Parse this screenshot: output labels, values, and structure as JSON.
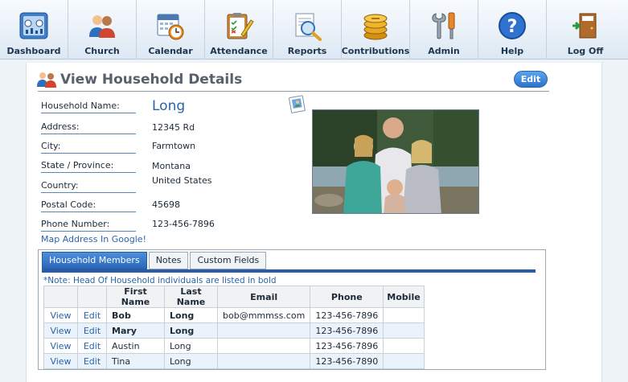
{
  "toolbar": {
    "items": [
      {
        "label": "Dashboard",
        "icon": "dashboard-icon"
      },
      {
        "label": "Church",
        "icon": "church-people-icon"
      },
      {
        "label": "Calendar",
        "icon": "calendar-icon"
      },
      {
        "label": "Attendance",
        "icon": "attendance-clipboard-icon"
      },
      {
        "label": "Reports",
        "icon": "reports-magnifier-icon"
      },
      {
        "label": "Contributions",
        "icon": "coins-icon"
      },
      {
        "label": "Admin",
        "icon": "tools-icon"
      },
      {
        "label": "Help",
        "icon": "help-icon"
      },
      {
        "label": "Log Off",
        "icon": "exit-door-icon"
      }
    ]
  },
  "page": {
    "title": "View Household Details",
    "edit_label": "Edit"
  },
  "household": {
    "labels": {
      "name": "Household Name:",
      "address": "Address:",
      "city": "City:",
      "state": "State / Province:",
      "country": "Country:",
      "postal": "Postal Code:",
      "phone": "Phone Number:"
    },
    "values": {
      "name": "Long",
      "address": "12345 Rd",
      "city": "Farmtown",
      "state": "Montana",
      "country": "United States",
      "postal": "45698",
      "phone": "123-456-7896"
    },
    "map_link": "Map Address In Google!"
  },
  "tabs": {
    "items": [
      "Household Members",
      "Notes",
      "Custom Fields"
    ],
    "active": 0
  },
  "members": {
    "note": "*Note: Head Of Household individuals are listed in bold",
    "headers": [
      "",
      "",
      "First Name",
      "Last Name",
      "Email",
      "Phone",
      "Mobile"
    ],
    "view_label": "View",
    "edit_label": "Edit",
    "rows": [
      {
        "first": "Bob",
        "last": "Long",
        "email": "bob@mmmss.com",
        "phone": "123-456-7896",
        "mobile": "",
        "bold": true
      },
      {
        "first": "Mary",
        "last": "Long",
        "email": "",
        "phone": "123-456-7896",
        "mobile": "",
        "bold": true
      },
      {
        "first": "Austin",
        "last": "Long",
        "email": "",
        "phone": "123-456-7896",
        "mobile": "",
        "bold": false
      },
      {
        "first": "Tina",
        "last": "Long",
        "email": "",
        "phone": "123-456-7890",
        "mobile": "",
        "bold": false
      }
    ]
  },
  "colors": {
    "accent": "#2a5ba6",
    "link": "#2b64a8",
    "title": "#57606b"
  }
}
